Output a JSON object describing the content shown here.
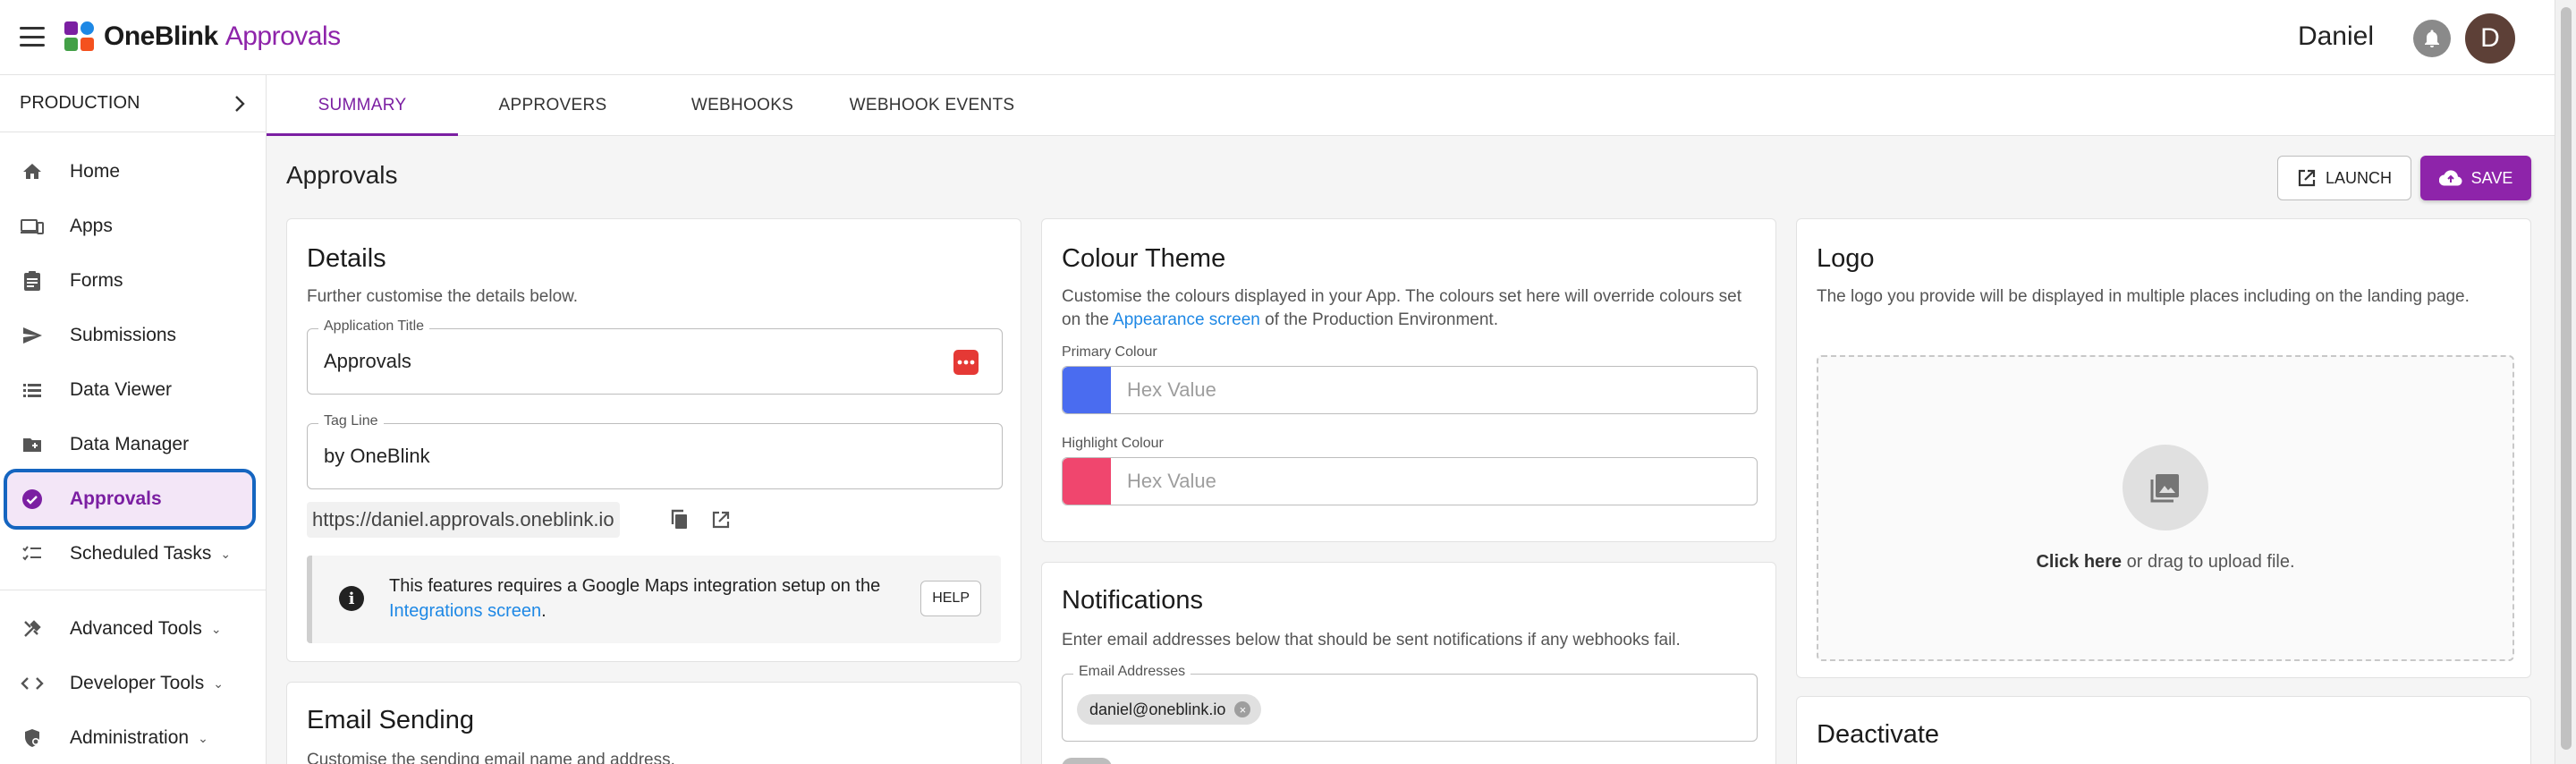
{
  "app": {
    "brand_bold": "OneBlink",
    "brand_light": "Approvals",
    "user_name": "Daniel",
    "avatar_initial": "D",
    "accent_color": "#8e24aa",
    "logo_colors": [
      "#7b1fa2",
      "#1e88e5",
      "#43a047",
      "#f4511e"
    ]
  },
  "sidebar": {
    "environment": "PRODUCTION",
    "items": [
      {
        "label": "Home",
        "icon": "home-icon"
      },
      {
        "label": "Apps",
        "icon": "devices-icon"
      },
      {
        "label": "Forms",
        "icon": "clipboard-icon"
      },
      {
        "label": "Submissions",
        "icon": "send-icon"
      },
      {
        "label": "Data Viewer",
        "icon": "list-icon"
      },
      {
        "label": "Data Manager",
        "icon": "folder-add-icon"
      },
      {
        "label": "Approvals",
        "icon": "check-circle-icon",
        "active": true
      },
      {
        "label": "Scheduled Tasks",
        "icon": "checklist-icon",
        "expandable": true
      },
      {
        "label": "Advanced Tools",
        "icon": "tools-icon",
        "expandable": true
      },
      {
        "label": "Developer Tools",
        "icon": "code-icon",
        "expandable": true
      },
      {
        "label": "Administration",
        "icon": "admin-icon",
        "expandable": true
      }
    ]
  },
  "tabs": [
    {
      "label": "SUMMARY",
      "active": true
    },
    {
      "label": "APPROVERS"
    },
    {
      "label": "WEBHOOKS"
    },
    {
      "label": "WEBHOOK EVENTS"
    }
  ],
  "header": {
    "title": "Approvals",
    "launch_label": "LAUNCH",
    "save_label": "SAVE"
  },
  "details": {
    "title": "Details",
    "description": "Further customise the details below.",
    "app_title_label": "Application Title",
    "app_title_value": "Approvals",
    "tag_line_label": "Tag Line",
    "tag_line_value": "by OneBlink",
    "url": "https://daniel.approvals.oneblink.io",
    "notice_text": "This features requires a Google Maps integration setup on the",
    "notice_link": "Integrations screen",
    "notice_after": ".",
    "help_label": "HELP"
  },
  "colour_theme": {
    "title": "Colour Theme",
    "description_before": "Customise the colours displayed in your App. The colours set here will override colours set on the",
    "description_link": "Appearance screen",
    "description_after": "of the Production Environment.",
    "primary_label": "Primary Colour",
    "primary_color": "#4a6cf0",
    "primary_placeholder": "Hex Value",
    "highlight_label": "Highlight Colour",
    "highlight_color": "#f0466e",
    "highlight_placeholder": "Hex Value"
  },
  "logo": {
    "title": "Logo",
    "description": "The logo you provide will be displayed in multiple places including on the landing page.",
    "upload_bold": "Click here",
    "upload_rest": "or drag to upload file."
  },
  "notifications": {
    "title": "Notifications",
    "description": "Enter email addresses below that should be sent notifications if any webhooks fail.",
    "email_label": "Email Addresses",
    "email_chip": "daniel@oneblink.io"
  },
  "email_sending": {
    "title": "Email Sending",
    "description": "Customise the sending email name and address."
  },
  "deactivate": {
    "title": "Deactivate"
  }
}
